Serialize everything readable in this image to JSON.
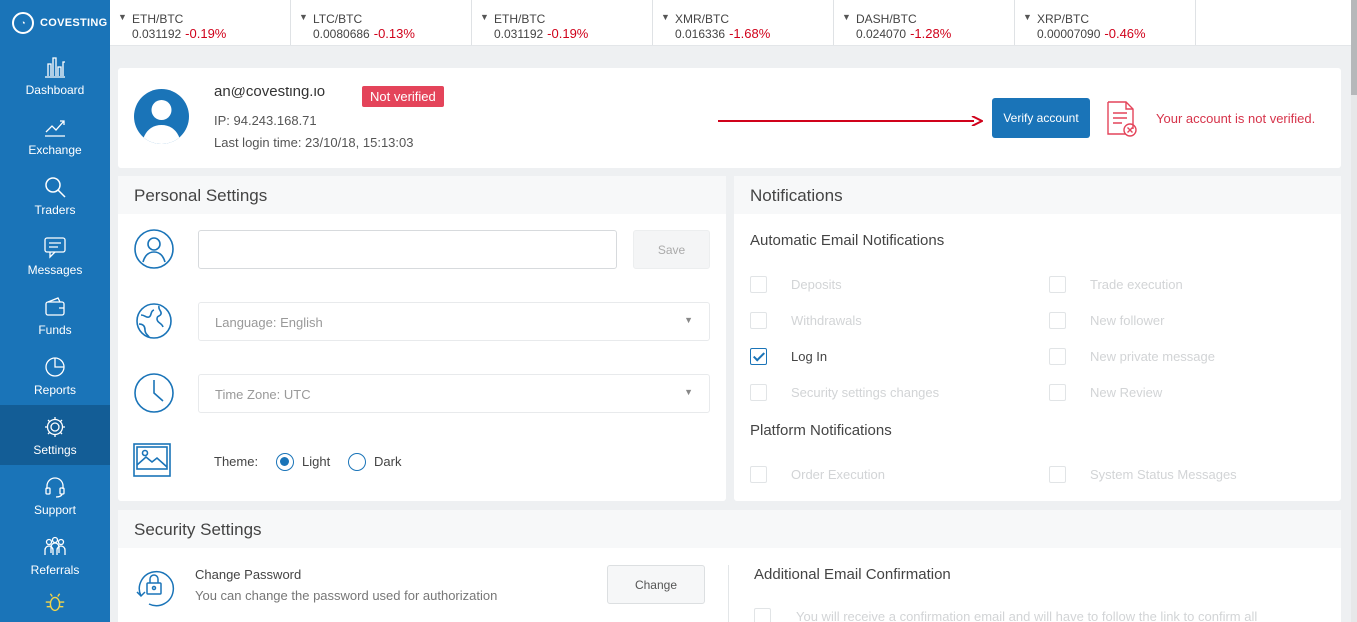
{
  "brand": {
    "name": "COVESTING"
  },
  "sidebar": {
    "items": [
      {
        "label": "Dashboard",
        "icon": "dashboard-icon"
      },
      {
        "label": "Exchange",
        "icon": "chart-line-icon"
      },
      {
        "label": "Traders",
        "icon": "search-icon"
      },
      {
        "label": "Messages",
        "icon": "chat-icon"
      },
      {
        "label": "Funds",
        "icon": "wallet-icon"
      },
      {
        "label": "Reports",
        "icon": "pie-chart-icon"
      },
      {
        "label": "Settings",
        "icon": "gear-icon",
        "active": true
      },
      {
        "label": "Support",
        "icon": "headset-icon"
      },
      {
        "label": "Referrals",
        "icon": "people-icon"
      }
    ]
  },
  "ticker": [
    {
      "pair": "ETH/BTC",
      "price": "0.031192",
      "change": "-0.19%"
    },
    {
      "pair": "LTC/BTC",
      "price": "0.0080686",
      "change": "-0.13%"
    },
    {
      "pair": "ETH/BTC",
      "price": "0.031192",
      "change": "-0.19%"
    },
    {
      "pair": "XMR/BTC",
      "price": "0.016336",
      "change": "-1.68%"
    },
    {
      "pair": "DASH/BTC",
      "price": "0.024070",
      "change": "-1.28%"
    },
    {
      "pair": "XRP/BTC",
      "price": "0.00007090",
      "change": "-0.46%"
    }
  ],
  "profile": {
    "email": "an@covesting.io",
    "ip": "IP: 94.243.168.71",
    "last_login": "Last login time: 23/10/18, 15:13:03",
    "status_badge": "Not verified",
    "verify_button": "Verify account",
    "not_verified_message": "Your account is not verified."
  },
  "personal_settings": {
    "title": "Personal Settings",
    "name_value": "",
    "save_button": "Save",
    "language": "Language: English",
    "timezone": "Time Zone: UTC",
    "theme_label": "Theme:",
    "theme_options": [
      {
        "label": "Light",
        "selected": true
      },
      {
        "label": "Dark",
        "selected": false
      }
    ]
  },
  "notifications": {
    "title": "Notifications",
    "email_section": "Automatic Email Notifications",
    "email_left": [
      {
        "label": "Deposits",
        "checked": false
      },
      {
        "label": "Withdrawals",
        "checked": false
      },
      {
        "label": "Log In",
        "checked": true
      },
      {
        "label": "Security settings changes",
        "checked": false
      }
    ],
    "email_right": [
      {
        "label": "Trade execution",
        "checked": false
      },
      {
        "label": "New follower",
        "checked": false
      },
      {
        "label": "New private message",
        "checked": false
      },
      {
        "label": "New Review",
        "checked": false
      }
    ],
    "platform_section": "Platform Notifications",
    "platform_left": {
      "label": "Order Execution",
      "checked": false
    },
    "platform_right": {
      "label": "System Status Messages",
      "checked": false
    }
  },
  "security_settings": {
    "title": "Security Settings",
    "change_password_title": "Change Password",
    "change_password_desc": "You can change the password used for authorization",
    "change_button": "Change",
    "additional_email_title": "Additional Email Confirmation",
    "additional_email_desc": "You will receive a confirmation email and will have to follow the link to confirm all"
  },
  "colors": {
    "primary": "#1a74b8",
    "negative": "#d0021b",
    "badge": "#e4445a"
  }
}
